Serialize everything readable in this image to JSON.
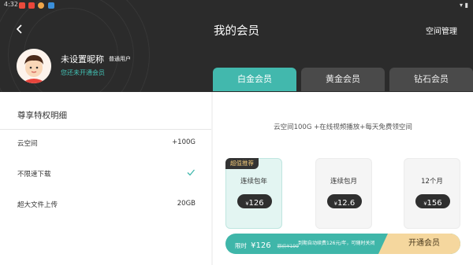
{
  "status_bar": {
    "time": "4:32"
  },
  "header": {
    "title": "我的会员",
    "right_action": "空间管理"
  },
  "user": {
    "nickname": "未设置昵称",
    "type": "普通用户",
    "status_link": "您还未开通会员"
  },
  "tabs": [
    {
      "label": "白金会员",
      "active": true
    },
    {
      "label": "黄金会员",
      "active": false
    },
    {
      "label": "钻石会员",
      "active": false
    }
  ],
  "privileges": {
    "title": "尊享特权明细",
    "items": [
      {
        "label": "云空间",
        "value": "+100G"
      },
      {
        "label": "不限速下载",
        "value": "",
        "icon": "check-icon"
      },
      {
        "label": "超大文件上传",
        "value": "20GB"
      }
    ]
  },
  "plan_description": "云空间100G +在线视频播放+每天免费领空间",
  "plans": [
    {
      "badge": "超值推荐",
      "name": "连续包年",
      "currency": "¥",
      "price": "126",
      "selected": true
    },
    {
      "badge": "",
      "name": "连续包月",
      "currency": "¥",
      "price": "12.6",
      "selected": false
    },
    {
      "badge": "",
      "name": "12个月",
      "currency": "¥",
      "price": "156",
      "selected": false
    }
  ],
  "buy_bar": {
    "limited_label": "限时",
    "currency": "¥",
    "price": "126",
    "original_price": "原价¥199",
    "note": "到期自动续费126元/年，可随时关闭",
    "button": "开通会员"
  },
  "colors": {
    "accent": "#42b8ad",
    "header_bg": "#2b2b2b",
    "buy_button": "#f5d79e"
  }
}
